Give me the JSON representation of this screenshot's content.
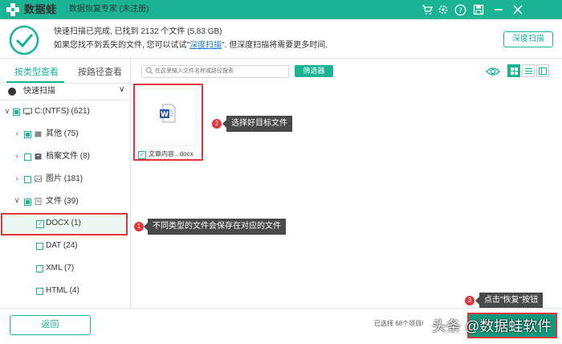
{
  "app": {
    "logo_text": "数据蛙",
    "subtitle": "数据恢复专家 (未注册)"
  },
  "header": {
    "status_line1": "快速扫描已完成, 已找到 2132 个文件 (5.83 GB)",
    "status_line2_before": "如果您找不到丢失的文件, 您可以试试\"",
    "status_line2_link": "深度扫描",
    "status_line2_after": "\". 但深度扫描将需要更多时间.",
    "deep_scan_button": "深度扫描"
  },
  "sidebar": {
    "tabs": [
      "按类型查看",
      "按路径查看"
    ],
    "quick_scan": "快速扫描",
    "tree": {
      "drive": "C:(NTFS) (621)",
      "other": "其他 (75)",
      "archive": "档案文件 (8)",
      "images": "图片 (181)",
      "documents": "文件 (39)",
      "docx": "DOCX (1)",
      "dat": "DAT (24)",
      "xml": "XML (7)",
      "html": "HTML (4)"
    }
  },
  "toolbar": {
    "search_placeholder": "在这里输入文件名称或路径搜索",
    "filter_button": "筛选器"
  },
  "file": {
    "name": "文章内容...docx"
  },
  "annotations": {
    "tip1_number": "1",
    "tip1_text": "不同类型的文件会保存在对应的文件",
    "tip2_number": "2",
    "tip2_text": "选择好目标文件",
    "tip3_number": "3",
    "tip3_text": "点击\"恢复\"按钮"
  },
  "footer": {
    "back_button": "返回",
    "selection_summary": "已选择 68个项目/",
    "watermark": "头条 @数据蛙软件"
  },
  "colors": {
    "brand": "#1ab394",
    "highlight_red": "#e0363c",
    "tooltip_bg": "#4a4a4a"
  },
  "icons": [
    "logo-icon",
    "cart-icon",
    "gear-icon",
    "help-icon",
    "save-icon",
    "minimize-icon",
    "close-icon",
    "check-circle-icon",
    "search-icon",
    "eye-icon",
    "grid-view-icon",
    "list-view-icon",
    "detail-view-icon",
    "word-file-icon",
    "drive-icon",
    "folder-icon",
    "image-icon",
    "document-icon"
  ]
}
